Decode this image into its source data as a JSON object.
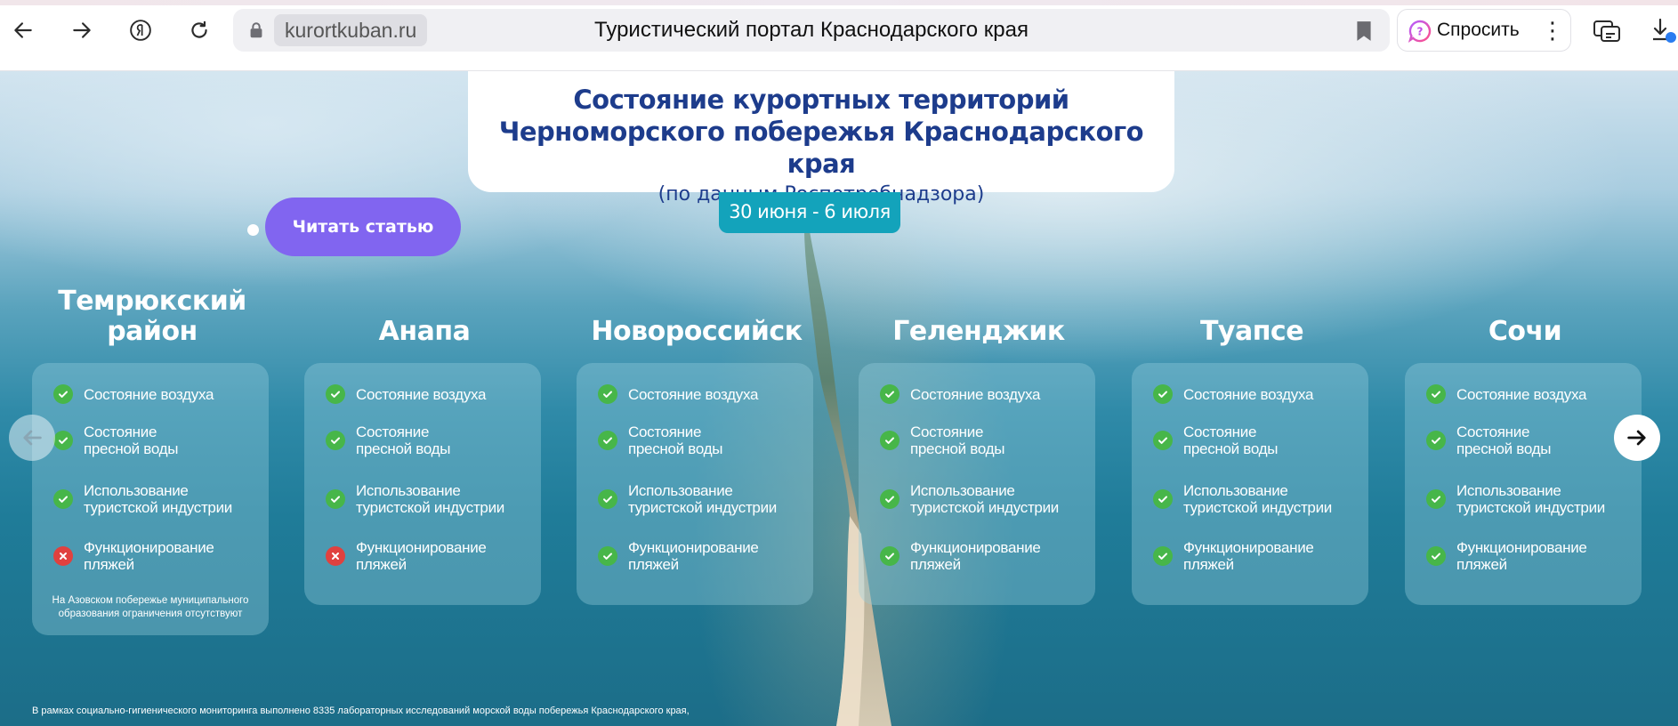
{
  "browser": {
    "domain": "kurortkuban.ru",
    "page_title": "Туристический портал Краснодарского края",
    "ask_label": "Спросить",
    "icons": [
      "back-icon",
      "forward-icon",
      "yandex-icon",
      "reload-icon",
      "lock-icon",
      "bookmark-icon",
      "alice-icon",
      "more-icon",
      "extensions-icon",
      "download-icon"
    ]
  },
  "banner": {
    "title_line1": "Состояние курортных территорий",
    "title_line2": "Черноморского побережья Краснодарского края",
    "subtitle": "(по данным Роспотребнадзора)",
    "date_range": "30 июня - 6 июля"
  },
  "read_button": "Читать статью",
  "colors": {
    "title_blue": "#1d3c8c",
    "badge_teal": "#13a3bb",
    "button_purple": "#8165f0",
    "ok_green": "#47b649",
    "bad_red": "#e0413f"
  },
  "cities": [
    {
      "name_line1": "Темрюкский",
      "name_line2": "район",
      "items": [
        {
          "line1": "Состояние воздуха",
          "line2": "",
          "status": "ok"
        },
        {
          "line1": "Состояние",
          "line2": "пресной воды",
          "status": "ok"
        },
        {
          "line1": "Использование",
          "line2": "туристской индустрии",
          "status": "ok"
        },
        {
          "line1": "Функционирование",
          "line2": "пляжей",
          "status": "bad"
        }
      ],
      "note_line1": "На Азовском побережье муниципального",
      "note_line2": "образования ограничения отсутствуют"
    },
    {
      "name_line1": "Анапа",
      "name_line2": "",
      "items": [
        {
          "line1": "Состояние воздуха",
          "line2": "",
          "status": "ok"
        },
        {
          "line1": "Состояние",
          "line2": "пресной воды",
          "status": "ok"
        },
        {
          "line1": "Использование",
          "line2": "туристской индустрии",
          "status": "ok"
        },
        {
          "line1": "Функционирование",
          "line2": "пляжей",
          "status": "bad"
        }
      ]
    },
    {
      "name_line1": "Новороссийск",
      "name_line2": "",
      "items": [
        {
          "line1": "Состояние воздуха",
          "line2": "",
          "status": "ok"
        },
        {
          "line1": "Состояние",
          "line2": "пресной воды",
          "status": "ok"
        },
        {
          "line1": "Использование",
          "line2": "туристской индустрии",
          "status": "ok"
        },
        {
          "line1": "Функционирование",
          "line2": "пляжей",
          "status": "ok"
        }
      ]
    },
    {
      "name_line1": "Геленджик",
      "name_line2": "",
      "items": [
        {
          "line1": "Состояние воздуха",
          "line2": "",
          "status": "ok"
        },
        {
          "line1": "Состояние",
          "line2": "пресной воды",
          "status": "ok"
        },
        {
          "line1": "Использование",
          "line2": "туристской индустрии",
          "status": "ok"
        },
        {
          "line1": "Функционирование",
          "line2": "пляжей",
          "status": "ok"
        }
      ]
    },
    {
      "name_line1": "Туапсе",
      "name_line2": "",
      "items": [
        {
          "line1": "Состояние воздуха",
          "line2": "",
          "status": "ok"
        },
        {
          "line1": "Состояние",
          "line2": "пресной воды",
          "status": "ok"
        },
        {
          "line1": "Использование",
          "line2": "туристской индустрии",
          "status": "ok"
        },
        {
          "line1": "Функционирование",
          "line2": "пляжей",
          "status": "ok"
        }
      ]
    },
    {
      "name_line1": "Сочи",
      "name_line2": "",
      "items": [
        {
          "line1": "Состояние воздуха",
          "line2": "",
          "status": "ok"
        },
        {
          "line1": "Состояние",
          "line2": "пресной воды",
          "status": "ok"
        },
        {
          "line1": "Использование",
          "line2": "туристской индустрии",
          "status": "ok"
        },
        {
          "line1": "Функционирование",
          "line2": "пляжей",
          "status": "ok"
        }
      ]
    }
  ],
  "footnote": {
    "line1": "В рамках социально-гигиенического мониторинга выполнено 8335 лабораторных исследований морской воды побережья Краснодарского края,"
  }
}
